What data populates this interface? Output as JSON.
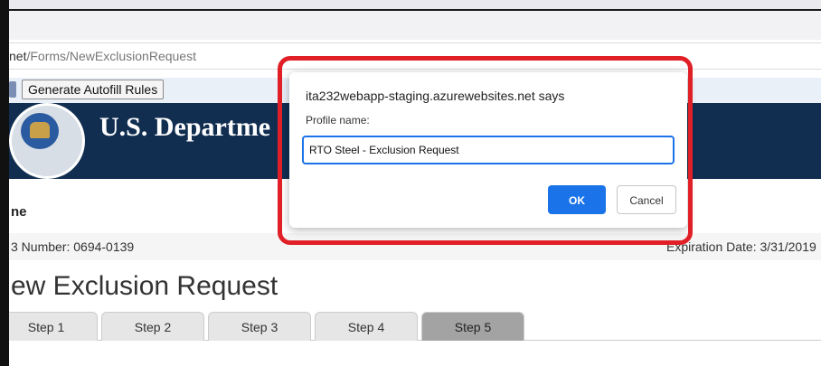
{
  "browser": {
    "url_prefix": "net",
    "url_path": "/Forms/NewExclusionRequest",
    "autofill_button_label": "Generate Autofill Rules"
  },
  "page": {
    "department_title": "U.S. Departme",
    "home_label": "ne",
    "omb_number": "3 Number: 0694-0139",
    "expiration_date": "Expiration Date: 3/31/2019",
    "heading": "ew Exclusion Request",
    "tabs": [
      {
        "label": "Step 1"
      },
      {
        "label": "Step 2"
      },
      {
        "label": "Step 3"
      },
      {
        "label": "Step 4"
      },
      {
        "label": "Step 5"
      }
    ]
  },
  "dialog": {
    "title": "ita232webapp-staging.azurewebsites.net says",
    "prompt_label": "Profile name:",
    "input_value": "RTO Steel - Exclusion Request",
    "ok_label": "OK",
    "cancel_label": "Cancel"
  },
  "colors": {
    "header_navy": "#112e51",
    "ok_blue": "#1a73e8",
    "highlight_red": "#e01f26",
    "active_tab": "#a3a3a3"
  }
}
